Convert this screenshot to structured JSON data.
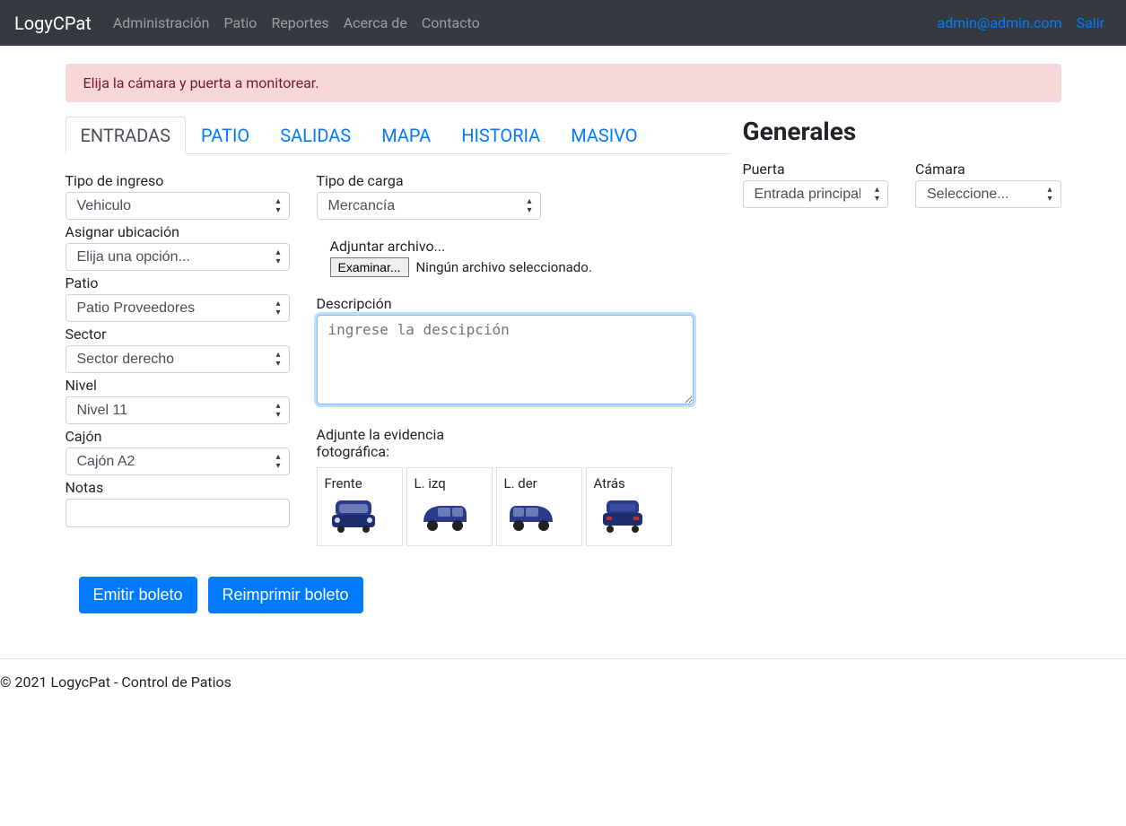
{
  "brand": "LogyCPat",
  "nav": {
    "administracion": "Administración",
    "patio": "Patio",
    "reportes": "Reportes",
    "acerca": "Acerca de",
    "contacto": "Contacto"
  },
  "user": {
    "email": "admin@admin.com",
    "logout": "Salir"
  },
  "alert": "Elija la cámara y puerta a monitorear.",
  "tabs": {
    "entradas": "ENTRADAS",
    "patio": "PATIO",
    "salidas": "SALIDAS",
    "mapa": "MAPA",
    "historia": "HISTORIA",
    "masivo": "MASIVO"
  },
  "form": {
    "tipo_ingreso": {
      "label": "Tipo de ingreso",
      "value": "Vehiculo"
    },
    "asignar_ubicacion": {
      "label": "Asignar ubicación",
      "value": "Elija una opción..."
    },
    "patio": {
      "label": "Patio",
      "value": "Patio Proveedores"
    },
    "sector": {
      "label": "Sector",
      "value": "Sector derecho"
    },
    "nivel": {
      "label": "Nivel",
      "value": "Nivel 11"
    },
    "cajon": {
      "label": "Cajón",
      "value": "Cajón A2"
    },
    "notas": {
      "label": "Notas",
      "value": ""
    },
    "tipo_carga": {
      "label": "Tipo de carga",
      "value": "Mercancía"
    },
    "adjuntar": {
      "label": "Adjuntar archivo...",
      "button": "Examinar...",
      "status": "Ningún archivo seleccionado."
    },
    "descripcion": {
      "label": "Descripción",
      "placeholder": "ingrese la descipción"
    },
    "evidencia": {
      "label": "Adjunte la evidencia fotográfica:",
      "frente": "Frente",
      "lizq": "L. izq",
      "lder": "L. der",
      "atras": "Atrás"
    }
  },
  "buttons": {
    "emitir": "Emitir boleto",
    "reimprimir": "Reimprimir boleto"
  },
  "generals": {
    "title": "Generales",
    "puerta": {
      "label": "Puerta",
      "value": "Entrada principal"
    },
    "camara": {
      "label": "Cámara",
      "value": "Seleccione..."
    }
  },
  "footer": "© 2021 LogycPat - Control de Patios"
}
